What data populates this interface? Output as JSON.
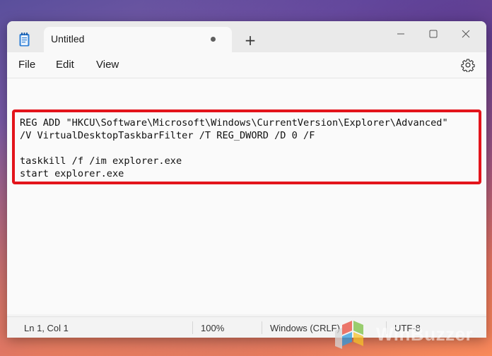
{
  "tab": {
    "title": "Untitled"
  },
  "new_tab_label": "+",
  "window_controls": {
    "minimize": "—",
    "maximize": "☐",
    "close": "✕"
  },
  "menu": {
    "file": "File",
    "edit": "Edit",
    "view": "View"
  },
  "editor": {
    "lines": [
      "REG ADD \"HKCU\\Software\\Microsoft\\Windows\\CurrentVersion\\Explorer\\Advanced\"",
      "/V VirtualDesktopTaskbarFilter /T REG_DWORD /D 0 /F",
      "",
      "taskkill /f /im explorer.exe",
      "start explorer.exe"
    ]
  },
  "status": {
    "position": "Ln 1, Col 1",
    "zoom": "100%",
    "line_ending": "Windows (CRLF)",
    "encoding": "UTF-8"
  },
  "watermark": {
    "text": "WinBuzzer"
  },
  "colors": {
    "highlight_border": "#e3141b",
    "window_bg": "#f3f3f3",
    "editor_bg": "#fafafa"
  },
  "icons": {
    "app": "notepad-icon",
    "settings": "gear-icon",
    "unsaved": "unsaved-dot-icon"
  }
}
